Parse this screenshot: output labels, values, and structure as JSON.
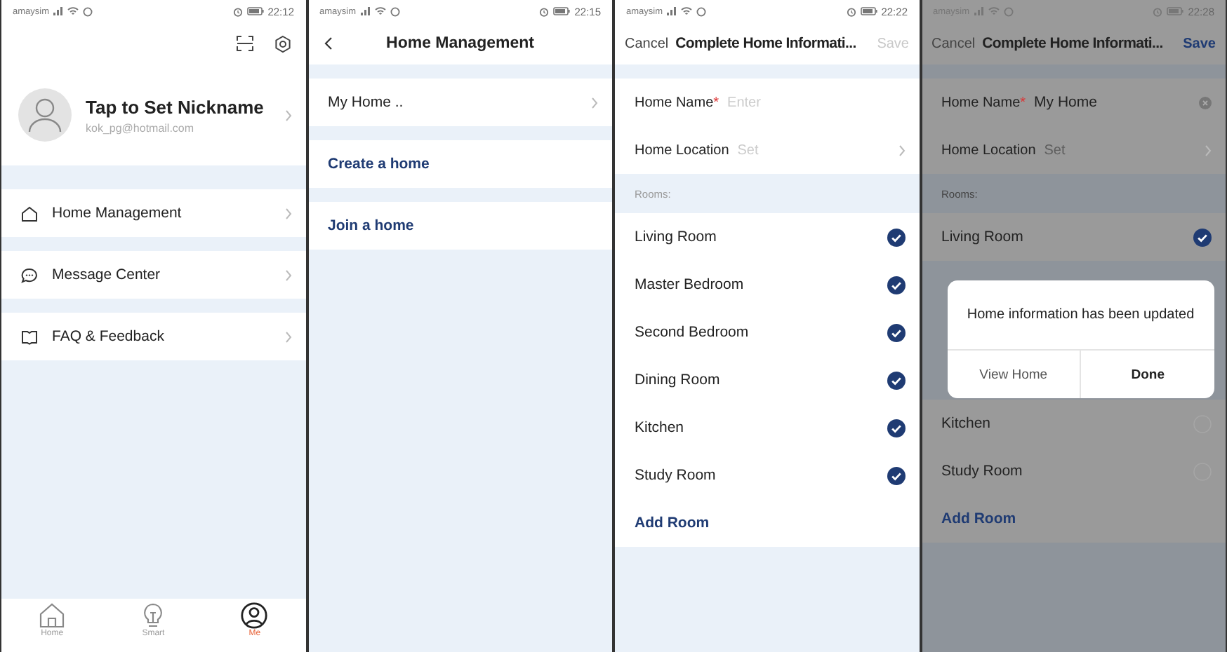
{
  "screens": [
    {
      "kind": "profile",
      "status": {
        "carrier": "amaysim",
        "time": "22:12"
      },
      "nickname": "Tap to Set Nickname",
      "email": "kok_pg@hotmail.com",
      "menu": [
        {
          "label": "Home Management",
          "group_start": true
        },
        {
          "label": "Message Center",
          "group_start": true
        },
        {
          "label": "FAQ & Feedback",
          "group_start": false
        }
      ],
      "nav": [
        {
          "label": "Home",
          "selected": false
        },
        {
          "label": "Smart",
          "selected": false
        },
        {
          "label": "Me",
          "selected": true
        }
      ]
    },
    {
      "kind": "management",
      "status": {
        "carrier": "amaysim",
        "time": "22:15"
      },
      "title": "Home Management",
      "items": [
        {
          "kind": "item",
          "label": "My Home .."
        },
        {
          "kind": "action",
          "label": "Create a home"
        },
        {
          "kind": "action",
          "label": "Join a home"
        }
      ]
    },
    {
      "kind": "form",
      "dimmed": false,
      "status": {
        "carrier": "amaysim",
        "time": "22:22"
      },
      "cancel": "Cancel",
      "title": "Complete Home Informati...",
      "save": {
        "label": "Save",
        "disabled": true
      },
      "name_label": "Home Name",
      "required_mark": "*",
      "name_placeholder": "Enter",
      "location_label": "Home Location",
      "location_placeholder": "Set",
      "rooms_label": "Rooms:",
      "rooms": [
        {
          "name": "Living Room",
          "checked": true
        },
        {
          "name": "Master Bedroom",
          "checked": true
        },
        {
          "name": "Second Bedroom",
          "checked": true
        },
        {
          "name": "Dining Room",
          "checked": true
        },
        {
          "name": "Kitchen",
          "checked": true
        },
        {
          "name": "Study Room",
          "checked": true
        }
      ],
      "add_room": "Add Room"
    },
    {
      "kind": "form",
      "dimmed": true,
      "status": {
        "carrier": "amaysim",
        "time": "22:28"
      },
      "cancel": "Cancel",
      "title": "Complete Home Informati...",
      "save": {
        "label": "Save",
        "disabled": false
      },
      "name_label": "Home Name",
      "required_mark": "*",
      "name_value": "My Home",
      "location_label": "Home Location",
      "location_placeholder": "Set",
      "rooms_label": "Rooms:",
      "rooms": [
        {
          "name": "Living Room",
          "checked": true
        },
        {
          "name": "Kitchen",
          "checked": false
        },
        {
          "name": "Study Room",
          "checked": false
        }
      ],
      "dialog": {
        "message": "Home information has been updated",
        "buttons": [
          {
            "kind": "secondary",
            "label": "View Home"
          },
          {
            "kind": "primary",
            "label": "Done"
          }
        ]
      },
      "add_room": "Add Room"
    }
  ]
}
